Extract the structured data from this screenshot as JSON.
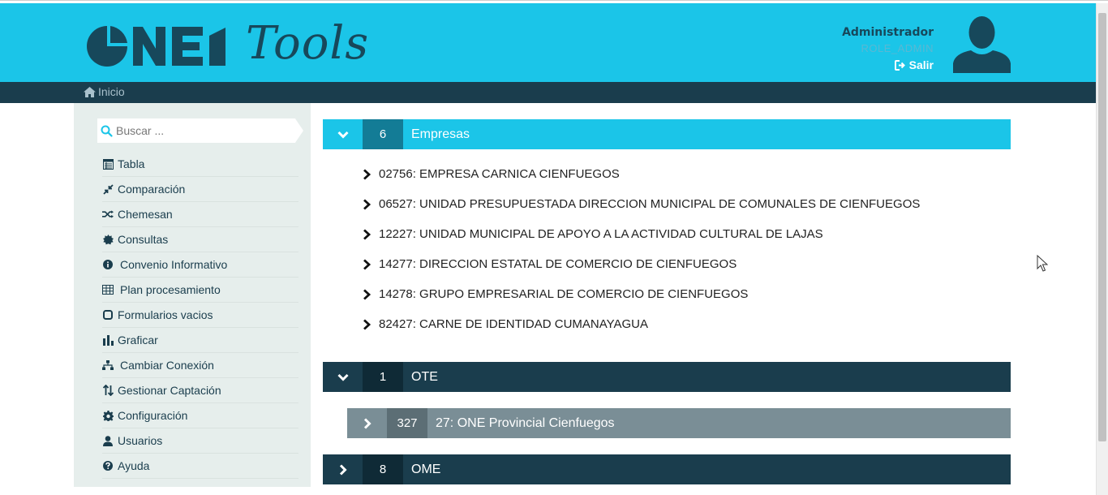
{
  "header": {
    "logo_text": "ONE",
    "logo_subtitle": "Tools",
    "user_name": "Administrador",
    "user_role": "ROLE_ADMIN",
    "logout_label": "Salir"
  },
  "breadcrumb": {
    "home_label": "Inicio"
  },
  "sidebar": {
    "search_placeholder": "Buscar ...",
    "items": [
      {
        "label": "Tabla",
        "icon": "table-icon"
      },
      {
        "label": "Comparación",
        "icon": "compress-icon"
      },
      {
        "label": "Chemesan",
        "icon": "random-icon"
      },
      {
        "label": "Consultas",
        "icon": "certificate-icon"
      },
      {
        "label": "Convenio Informativo",
        "icon": "info-icon"
      },
      {
        "label": "Plan procesamiento",
        "icon": "grid-icon"
      },
      {
        "label": "Formularios vacios",
        "icon": "square-icon"
      },
      {
        "label": "Graficar",
        "icon": "bar-chart-icon"
      },
      {
        "label": "Cambiar Conexión",
        "icon": "sitemap-icon"
      },
      {
        "label": "Gestionar Captación",
        "icon": "sort-icon"
      },
      {
        "label": "Configuración",
        "icon": "gear-icon"
      },
      {
        "label": "Usuarios",
        "icon": "user-icon"
      },
      {
        "label": "Ayuda",
        "icon": "question-icon"
      }
    ]
  },
  "main": {
    "empresas": {
      "count": "6",
      "title": "Empresas",
      "items": [
        "02756: EMPRESA CARNICA CIENFUEGOS",
        "06527: UNIDAD PRESUPUESTADA DIRECCION MUNICIPAL DE COMUNALES DE CIENFUEGOS",
        "12227: UNIDAD MUNICIPAL DE APOYO A LA ACTIVIDAD CULTURAL DE LAJAS",
        "14277: DIRECCION ESTATAL DE COMERCIO DE CIENFUEGOS",
        "14278: GRUPO EMPRESARIAL DE COMERCIO DE CIENFUEGOS",
        "82427: CARNE DE IDENTIDAD CUMANAYAGUA"
      ]
    },
    "ote": {
      "count": "1",
      "title": "OTE"
    },
    "provincial": {
      "count": "327",
      "title": "27: ONE Provincial Cienfuegos"
    },
    "ome": {
      "count": "8",
      "title": "OME"
    }
  },
  "colors": {
    "header_bg": "#1bc5e8",
    "dark_navy": "#1a3d4d",
    "sidebar_bg": "#e6eeec",
    "accent_count": "#137c96",
    "gray_panel": "#7a8e96"
  }
}
